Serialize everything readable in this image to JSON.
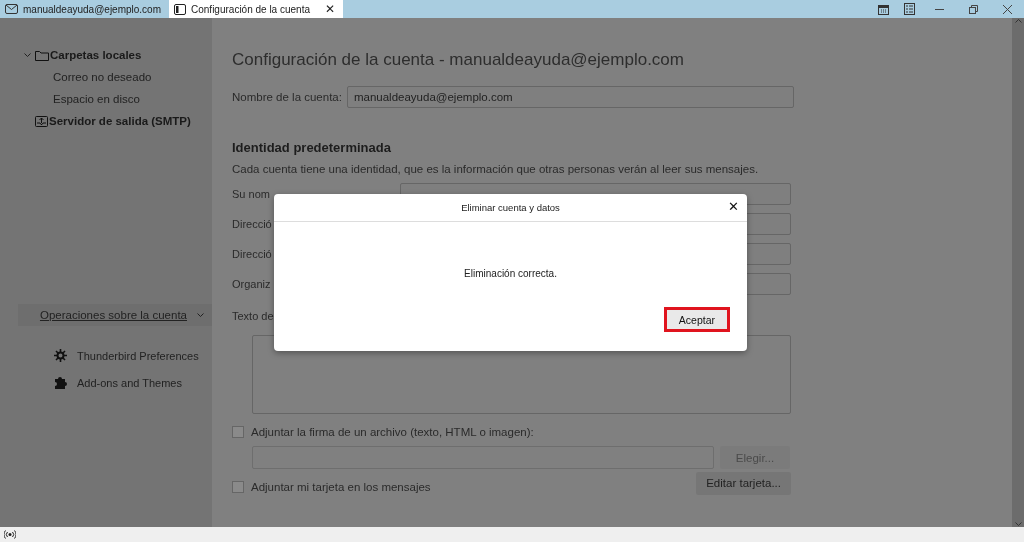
{
  "tabs": [
    {
      "label": "manualdeayuda@ejemplo.com",
      "selected": false,
      "kind": "mail"
    },
    {
      "label": "Configuración de la cuenta",
      "selected": true,
      "kind": "settings",
      "close": "✕"
    }
  ],
  "sidebar": {
    "folders": [
      {
        "label": "Carpetas locales",
        "kind": "folder",
        "children": [
          {
            "label": "Correo no deseado"
          },
          {
            "label": "Espacio en disco"
          }
        ]
      },
      {
        "label": "Servidor de salida (SMTP)",
        "kind": "outbox"
      }
    ],
    "account_operations": "Operaciones sobre la cuenta",
    "links": [
      {
        "label": "Thunderbird Preferences",
        "kind": "gear"
      },
      {
        "label": "Add-ons and Themes",
        "kind": "puzzle"
      }
    ]
  },
  "main": {
    "title": "Configuración de la cuenta - manualdeayuda@ejemplo.com",
    "account_name": {
      "label": "Nombre de la cuenta:",
      "value": "manualdeayuda@ejemplo.com"
    },
    "identity_heading": "Identidad predeterminada",
    "identity_description": "Cada cuenta tiene una identidad, que es la información que otras personas verán al leer sus mensajes.",
    "fields": [
      {
        "label": "Su nom"
      },
      {
        "label": "Direcció"
      },
      {
        "label": "Direcció"
      },
      {
        "label": "Organiz"
      }
    ],
    "signature_label": "Texto de",
    "attach_signature": {
      "label": "Adjuntar la firma de un archivo (texto, HTML o imagen):",
      "checked": false
    },
    "choose_button": {
      "label": "Elegir...",
      "disabled": true
    },
    "attach_vcard": {
      "label": "Adjuntar mi tarjeta en los mensajes",
      "checked": false
    },
    "edit_card_button": "Editar tarjeta..."
  },
  "dialog": {
    "title": "Eliminar cuenta y datos",
    "close": "✕",
    "message": "Eliminación correcta.",
    "button": {
      "label": "Aceptar",
      "highlighted": true
    }
  }
}
